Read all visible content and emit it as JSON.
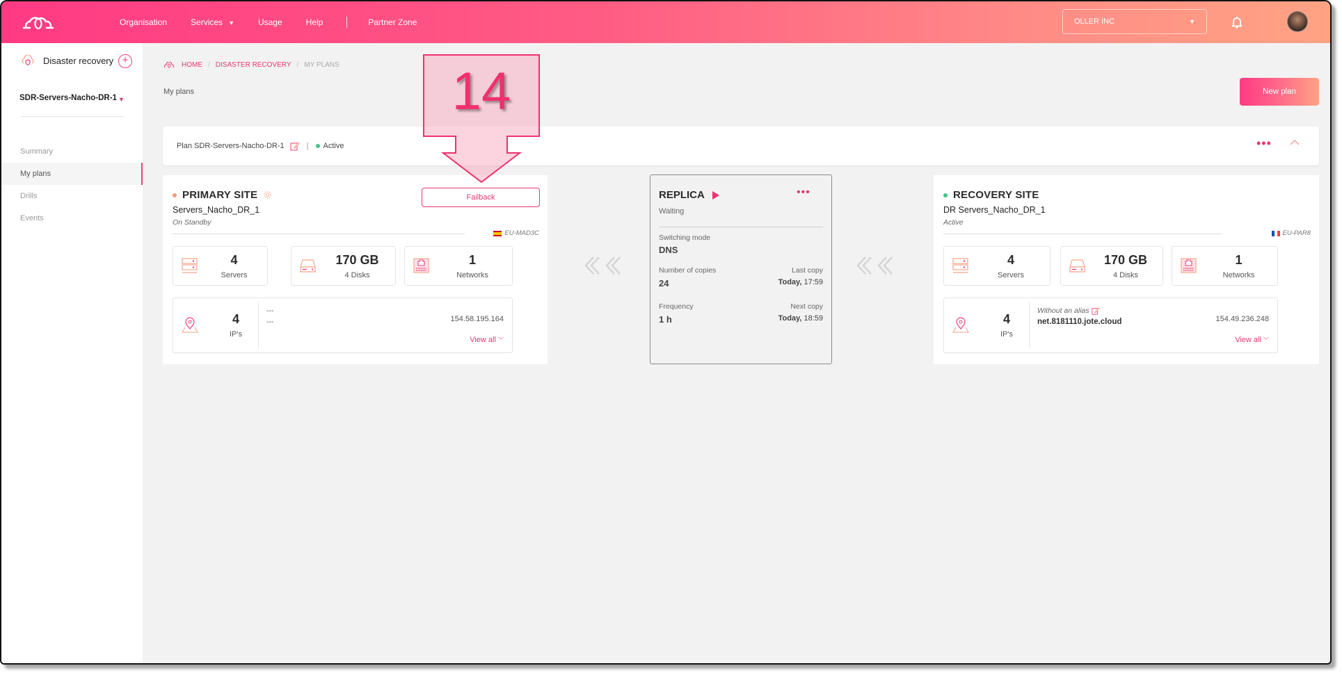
{
  "header": {
    "logo": "cloud-logo",
    "nav": [
      {
        "label": "Organisation"
      },
      {
        "label": "Services",
        "has_dropdown": true
      },
      {
        "label": "Usage"
      },
      {
        "label": "Help"
      },
      {
        "label": "Partner Zone"
      }
    ],
    "organization": "OLLER INC",
    "icons": {
      "notifications": "bell-icon",
      "user": "avatar"
    }
  },
  "sidebar": {
    "title": "Disaster recovery",
    "selected_plan": "SDR-Servers-Nacho-DR-1",
    "items": [
      {
        "label": "Summary",
        "active": false
      },
      {
        "label": "My plans",
        "active": true
      },
      {
        "label": "Drills",
        "active": false
      },
      {
        "label": "Events",
        "active": false
      }
    ]
  },
  "breadcrumb": {
    "home": "HOME",
    "section": "DISASTER RECOVERY",
    "current": "MY PLANS"
  },
  "page": {
    "title": "My plans",
    "new_plan_label": "New plan"
  },
  "plan": {
    "label": "Plan SDR-Servers-Nacho-DR-1",
    "status": "Active",
    "status_color": "#3ec486"
  },
  "primary_site": {
    "title": "PRIMARY SITE",
    "dot_color": "#f59a7c",
    "name": "Servers_Nacho_DR_1",
    "state": "On Standby",
    "region": "EU-MAD3C",
    "action_label": "Failback",
    "servers": {
      "value": "4",
      "label": "Servers"
    },
    "storage": {
      "value": "170 GB",
      "label": "4 Disks"
    },
    "networks": {
      "value": "1",
      "label": "Networks"
    },
    "ips": {
      "value": "4",
      "label": "IP's",
      "alias_line": "---",
      "host_line": "---",
      "address": "154.58.195.164",
      "view_all": "View all"
    }
  },
  "replica": {
    "title": "REPLICA",
    "status": "Waiting",
    "switching_mode_label": "Switching mode",
    "switching_mode": "DNS",
    "copies_label": "Number of copies",
    "copies": "24",
    "last_copy_label": "Last copy",
    "last_copy_day": "Today,",
    "last_copy_time": "17:59",
    "frequency_label": "Frequency",
    "frequency": "1 h",
    "next_copy_label": "Next copy",
    "next_copy_day": "Today,",
    "next_copy_time": "18:59"
  },
  "recovery_site": {
    "title": "RECOVERY SITE",
    "dot_color": "#3ec486",
    "name": "DR Servers_Nacho_DR_1",
    "state": "Active",
    "region": "EU-PAR8",
    "servers": {
      "value": "4",
      "label": "Servers"
    },
    "storage": {
      "value": "170 GB",
      "label": "4 Disks"
    },
    "networks": {
      "value": "1",
      "label": "Networks"
    },
    "ips": {
      "value": "4",
      "label": "IP's",
      "alias_line": "Without an alias",
      "host_line": "net.8181110.jote.cloud",
      "address": "154.49.236.248",
      "view_all": "View all"
    }
  },
  "annotation": {
    "step_number": "14",
    "color": "#f0306e"
  },
  "colors": {
    "accent": "#e8366f",
    "gradient_start": "#ff3a83",
    "gradient_end": "#ffa384"
  }
}
